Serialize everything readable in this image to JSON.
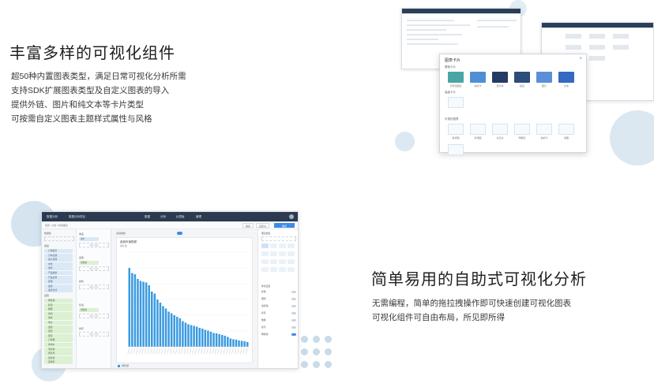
{
  "features": [
    {
      "title": "丰富多样的可视化组件",
      "lines": [
        "超50种内置图表类型，满足日常可视化分析所需",
        "支持SDK扩展图表类型及自定义图表的导入",
        "提供外链、图片和纯文本等卡片类型",
        "可按需自定义图表主题样式属性与风格"
      ]
    },
    {
      "title": "简单易用的自助式可视化分析",
      "lines": [
        "无需编程，简单的拖拉拽操作即可快速创建可视化图表",
        "可视化组件可自由布局，所见即所得"
      ]
    }
  ],
  "colors": {
    "topbar": "#2b3a50",
    "bar": "#3a9ae0",
    "accent": "#3e8be6",
    "dimension_chip": "#dbe8f6",
    "measure_chip": "#dcf0d2",
    "deco_circle": "#dce8f1"
  },
  "chart_dialog": {
    "title": "图表卡片",
    "close_icon": "close-icon",
    "sections": [
      "基础卡片",
      "高级卡片",
      "可视化图表"
    ],
    "basic_cards": [
      {
        "label": "可视化图表",
        "color": "#4aa5a5"
      },
      {
        "label": "指标卡",
        "color": "#4f8fd6"
      },
      {
        "label": "富文本",
        "color": "#243b63"
      },
      {
        "label": "链接",
        "color": "#2d4d7a"
      },
      {
        "label": "图片",
        "color": "#5b8fd9"
      },
      {
        "label": "文本",
        "color": "#3569c4"
      }
    ],
    "chart_types": [
      "柱状图",
      "折线图",
      "交叉表",
      "明细表",
      "指标卡",
      "饼图",
      "散点图"
    ]
  },
  "editor": {
    "app_name": "数据分析",
    "project": "数据分析项目",
    "top_nav": [
      "数据",
      "分析",
      "仪表板",
      "管理"
    ],
    "breadcrumb": "首页 / 分析 / 新建图表",
    "toolbar_buttons": [
      "保存",
      "另存为",
      "保存"
    ],
    "data_panel_label": "数据集",
    "dimension_label": "维度",
    "measure_label": "度量",
    "dimensions": [
      "订单编号",
      "订单日期",
      "客户名称",
      "省份",
      "城市",
      "产品类别",
      "产品名称",
      "区域",
      "渠道",
      "发货方式"
    ],
    "measures": [
      "销售额",
      "利润",
      "数量",
      "折扣",
      "成本",
      "单价",
      "运费",
      "回款",
      "库存",
      "订单量",
      "客单价",
      "毛利率",
      "增长率",
      "目标值",
      "完成率"
    ],
    "zones": [
      {
        "label": "维度",
        "chip": "城市",
        "type": "dim"
      },
      {
        "label": "度量",
        "chip": "销售额",
        "type": "mea"
      },
      {
        "label": "颜色",
        "chip": ""
      },
      {
        "label": "筛选",
        "chip": "销售额",
        "type": "mea"
      },
      {
        "label": "排序",
        "chip": ""
      }
    ],
    "drop_hint": "拖入字段",
    "canvas_toggle_label": "自动刷新",
    "card_title": "各城市销售额",
    "card_subtitle": "销售额",
    "legend": "销售额",
    "panel_title": "图表类型",
    "panel_sections": [
      "样式设置"
    ],
    "panel_options": [
      "标题",
      "图例",
      "坐标轴",
      "标签",
      "数据",
      "提示",
      "网格线"
    ]
  },
  "chart_data": {
    "type": "bar",
    "title": "",
    "values": [
      1000,
      935,
      920,
      860,
      835,
      825,
      815,
      780,
      700,
      675,
      600,
      560,
      515,
      485,
      445,
      425,
      400,
      380,
      360,
      325,
      305,
      285,
      275,
      265,
      255,
      240,
      230,
      215,
      205,
      190,
      175,
      170,
      160,
      150,
      140,
      125,
      105,
      95,
      90,
      80,
      75,
      70,
      60
    ],
    "ylim": [
      0,
      1200
    ],
    "grid": true
  }
}
